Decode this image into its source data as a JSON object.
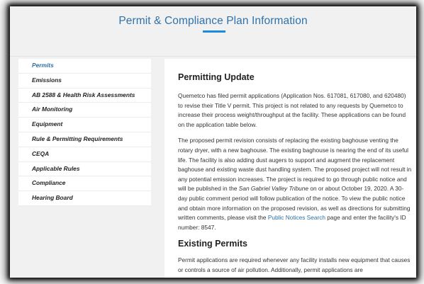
{
  "header": {
    "title": "Permit & Compliance Plan Information"
  },
  "sidebar": {
    "items": [
      {
        "label": "Permits",
        "active": true
      },
      {
        "label": "Emissions"
      },
      {
        "label": "AB 2588 & Health Risk Assessments"
      },
      {
        "label": "Air Monitoring"
      },
      {
        "label": "Equipment"
      },
      {
        "label": "Rule & Permitting Requirements"
      },
      {
        "label": "CEQA"
      },
      {
        "label": "Applicable Rules"
      },
      {
        "label": "Compliance"
      },
      {
        "label": "Hearing Board"
      }
    ]
  },
  "main": {
    "section1": {
      "heading": "Permitting Update",
      "para1": "Quemetco has filed permit applications (Application Nos. 617081, 617080, and 620480) to revise their Title V permit. This project is not related to any requests by Quemetco to increase their process weight/throughput at the facility. These applications can be found on the application table below.",
      "para2_part1": "The proposed permit revision consists of replacing the existing baghouse venting the rotary dryer, with a new baghouse. The existing baghouse is nearing the end of its useful life. The facility is also adding dust augers to support and augment the replacement baghouse and existing waste dust handling system. The proposed project will not result in any potential emission increases. The project is required to go through public notice and will be published in the ",
      "para2_italic": "San Gabriel Valley Tribune",
      "para2_part2": " on or about October 19, 2020. A 30-day public comment period will follow publication of the notice. To view the public notice and obtain more information on the proposed revision, as well as directions for submitting written comments, please visit the ",
      "para2_link": "Public Notices Search",
      "para2_part3": " page and enter the facility's ID number: 8547."
    },
    "section2": {
      "heading": "Existing Permits",
      "para1": "Permit applications are required whenever any facility installs new equipment that causes or controls a source of air pollution. Additionally, permit applications are"
    }
  }
}
